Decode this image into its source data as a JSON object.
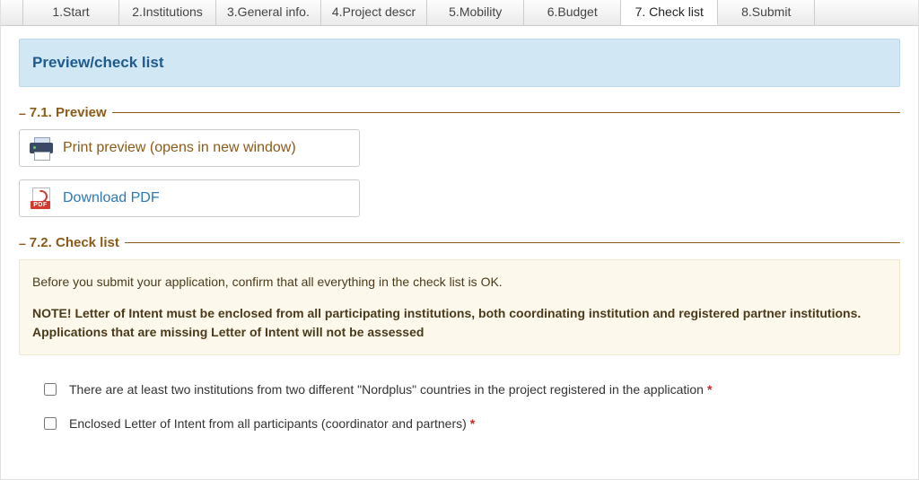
{
  "tabs": [
    {
      "label": "1.Start"
    },
    {
      "label": "2.Institutions"
    },
    {
      "label": "3.General info."
    },
    {
      "label": "4.Project descr"
    },
    {
      "label": "5.Mobility"
    },
    {
      "label": "6.Budget"
    },
    {
      "label": "7. Check list"
    },
    {
      "label": "8.Submit"
    }
  ],
  "active_tab_index": 6,
  "banner_title": "Preview/check list",
  "sections": {
    "preview": {
      "title": "7.1. Preview",
      "print_label": "Print preview (opens in new window)",
      "pdf_label": "Download PDF",
      "pdf_icon_tag": "PDF"
    },
    "checklist": {
      "title": "7.2. Check list",
      "note_intro": "Before you submit your application, confirm that all everything in the check list is OK.",
      "note_bold": "NOTE! Letter of Intent must be enclosed from all participating institutions, both coordinating institution and registered partner institutions. Applications that are missing Letter of Intent will not be assessed",
      "items": [
        {
          "text": "There are at least two institutions from two different \"Nordplus\" countries in the project registered in the application",
          "required": true,
          "checked": false
        },
        {
          "text": "Enclosed Letter of Intent from all participants (coordinator and partners)",
          "required": true,
          "checked": false
        }
      ],
      "required_marker": "*"
    }
  }
}
